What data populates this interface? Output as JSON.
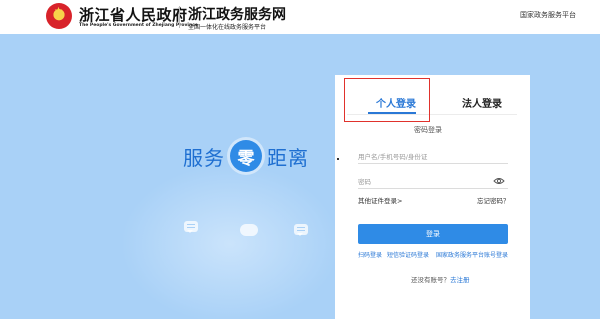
{
  "header": {
    "brand_title": "浙江省人民政府",
    "brand_subtitle": "The People's Government of Zhejiang Province",
    "service_title": "浙江政务服务网",
    "service_subtitle": "全国一体化在线政务服务平台",
    "national_link": "国家政务服务平台"
  },
  "banner": {
    "slogan_left": "服务",
    "slogan_mid": "零",
    "slogan_right": "距离",
    "background_color": "#a9d1f7"
  },
  "login": {
    "tabs": [
      {
        "label": "个人登录",
        "active": true
      },
      {
        "label": "法人登录",
        "active": false
      }
    ],
    "mode_label": "密码登录",
    "username_placeholder": "用户名/手机号码/身份证",
    "password_placeholder": "密码",
    "other_cert_link": "其他证件登录>",
    "forgot_link": "忘记密码？",
    "submit_label": "登录",
    "alt_links": [
      "扫码登录",
      "短信验证码登录",
      "国家政务服务平台账号登录"
    ],
    "register_prompt": "还没有账号？",
    "register_link": "去注册",
    "accent_color": "#2f8be6",
    "highlight_color": "#e0322c"
  }
}
